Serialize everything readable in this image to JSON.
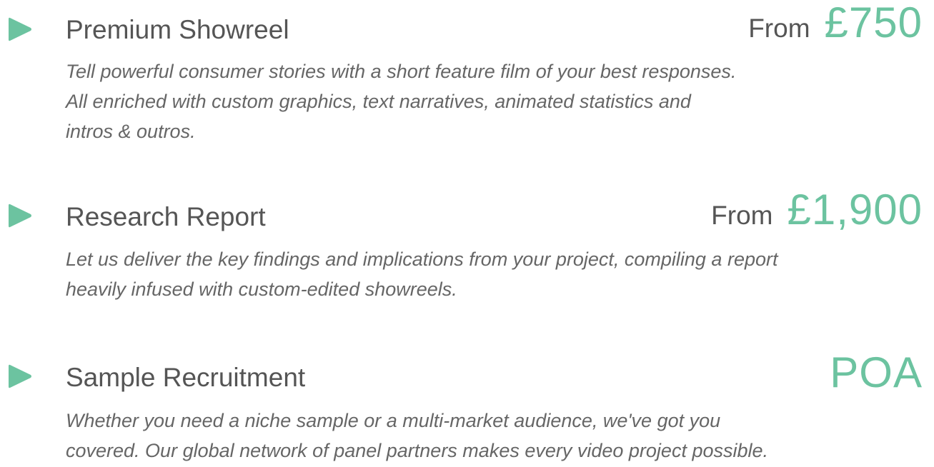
{
  "colors": {
    "accent": "#6cc3a0",
    "text": "#555555"
  },
  "services": [
    {
      "icon": "play-icon",
      "title": "Premium Showreel",
      "price_prefix": "From",
      "price": "£750",
      "description_lines": [
        "Tell powerful consumer stories with a short feature film of your best responses.",
        "All enriched with custom graphics, text narratives, animated statistics and",
        "intros & outros."
      ]
    },
    {
      "icon": "play-icon",
      "title": "Research Report",
      "price_prefix": "From",
      "price": "£1,900",
      "description_lines": [
        "Let us deliver the key findings and implications from your project, compiling a report",
        "heavily infused with custom-edited showreels."
      ]
    },
    {
      "icon": "play-icon",
      "title": "Sample Recruitment",
      "price_prefix": "",
      "price": "POA",
      "description_lines": [
        "Whether you need a niche sample or a multi-market audience, we've got you",
        "covered. Our global network of panel partners makes every video project possible."
      ]
    }
  ]
}
